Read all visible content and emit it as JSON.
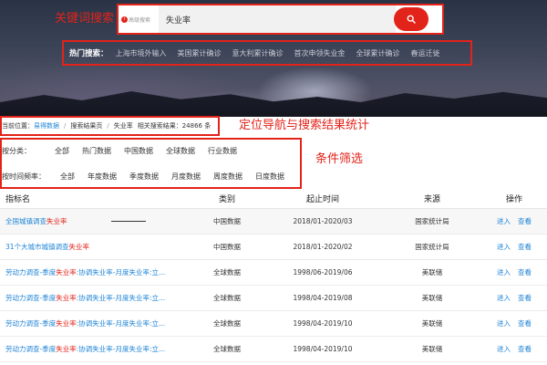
{
  "annotations": {
    "keyword_search": "关键词搜索",
    "nav_and_stats": "定位导航与搜索结果统计",
    "filters": "条件筛选",
    "color": "#e2231a"
  },
  "search": {
    "tag": "高级搜索",
    "tag_icon": "info-icon",
    "value": "失业率",
    "button_icon": "search-icon"
  },
  "hot": {
    "title": "热门搜索：",
    "items": [
      "上海市境外输入",
      "美国累计确诊",
      "意大利累计确诊",
      "首次申领失业金",
      "全球累计确诊",
      "春运迁徙"
    ]
  },
  "breadcrumb": {
    "prefix": "当前位置：",
    "home": "易得数据",
    "sep": "/",
    "results_page": "搜索结果页",
    "keyword": "失业率",
    "stats": "相关搜索结果：24866 条"
  },
  "filters": {
    "category_label": "按分类：",
    "categories": [
      "全部",
      "热门数据",
      "中国数据",
      "全球数据",
      "行业数据"
    ],
    "freq_label": "按时间频率：",
    "freqs": [
      "全部",
      "年度数据",
      "季度数据",
      "月度数据",
      "周度数据",
      "日度数据"
    ]
  },
  "table": {
    "headers": {
      "name": "指标名",
      "type": "类别",
      "time": "起止时间",
      "source": "来源",
      "ops": "操作"
    },
    "op_enter": "进入",
    "op_view": "查看",
    "rows": [
      {
        "name_pre": "全国城镇调查",
        "name_hl": "失业率",
        "name_post": "",
        "type": "中国数据",
        "time": "2018/01-2020/03",
        "source": "国家统计局"
      },
      {
        "name_pre": "31个大城市城镇调查",
        "name_hl": "失业率",
        "name_post": "",
        "type": "中国数据",
        "time": "2018/01-2020/02",
        "source": "国家统计局"
      },
      {
        "name_pre": "劳动力调查-季度",
        "name_hl": "失业率",
        "name_post": ":协调失业率-月度失业率:立...",
        "type": "全球数据",
        "time": "1998/06-2019/06",
        "source": "美联储"
      },
      {
        "name_pre": "劳动力调查-季度",
        "name_hl": "失业率",
        "name_post": ":协调失业率-月度失业率:立...",
        "type": "全球数据",
        "time": "1998/04-2019/08",
        "source": "美联储"
      },
      {
        "name_pre": "劳动力调查-季度",
        "name_hl": "失业率",
        "name_post": ":协调失业率-月度失业率:立...",
        "type": "全球数据",
        "time": "1998/04-2019/10",
        "source": "美联储"
      },
      {
        "name_pre": "劳动力调查-季度",
        "name_hl": "失业率",
        "name_post": ":协调失业率-月度失业率:立...",
        "type": "全球数据",
        "time": "1998/04-2019/10",
        "source": "美联储"
      }
    ]
  }
}
